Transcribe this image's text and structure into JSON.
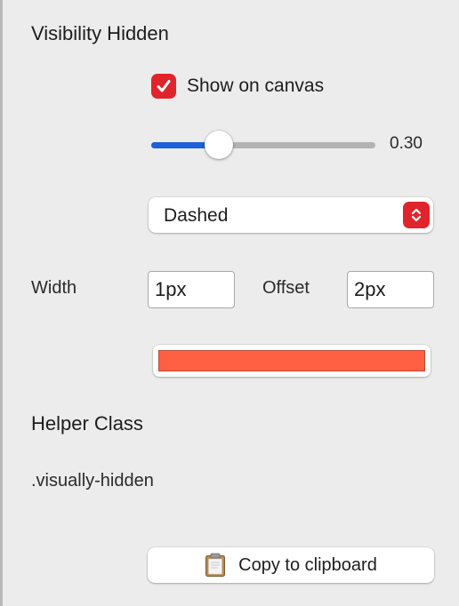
{
  "section": {
    "title": "Visibility Hidden",
    "show_on_canvas": {
      "label": "Show on canvas",
      "checked": true
    },
    "opacity": {
      "value": 0.3,
      "display": "0.30"
    },
    "border_style": {
      "selected": "Dashed"
    },
    "width": {
      "label": "Width",
      "value": "1px"
    },
    "offset": {
      "label": "Offset",
      "value": "2px"
    },
    "color": {
      "hex": "#ff6044"
    }
  },
  "helper": {
    "title": "Helper Class",
    "class_name": ".visually-hidden",
    "copy_label": "Copy to clipboard"
  },
  "icons": {
    "checkbox": "checkmark-icon",
    "select": "chevron-up-down-icon",
    "copy": "clipboard-icon"
  },
  "colors": {
    "accent": "#e0242b",
    "slider_fill": "#1c61d8",
    "background": "#ececec"
  }
}
